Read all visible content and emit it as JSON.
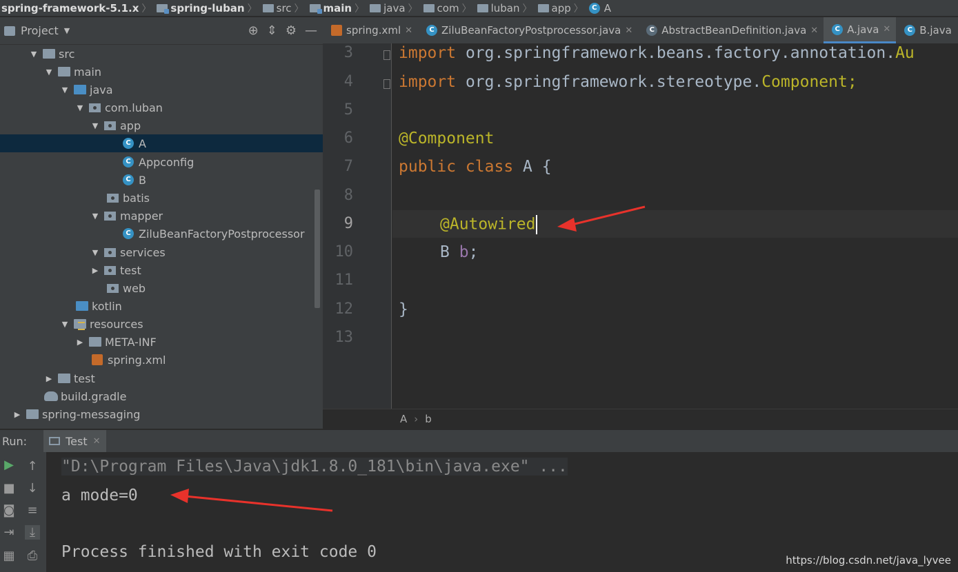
{
  "breadcrumb": [
    {
      "label": "spring-framework-5.1.x",
      "icon": "none",
      "bold": true
    },
    {
      "label": "spring-luban",
      "icon": "module-folder-icon",
      "bold": true
    },
    {
      "label": "src",
      "icon": "folder-icon",
      "bold": false
    },
    {
      "label": "main",
      "icon": "module-folder-icon",
      "bold": true
    },
    {
      "label": "java",
      "icon": "folder-icon",
      "bold": false
    },
    {
      "label": "com",
      "icon": "folder-icon",
      "bold": false
    },
    {
      "label": "luban",
      "icon": "folder-icon",
      "bold": false
    },
    {
      "label": "app",
      "icon": "folder-icon",
      "bold": false
    },
    {
      "label": "A",
      "icon": "class-icon",
      "bold": false
    }
  ],
  "project": {
    "title": "Project",
    "tree": [
      {
        "label": "src",
        "arrow": "▼",
        "icon": "folder",
        "selected": false
      },
      {
        "label": "main",
        "arrow": "▼",
        "icon": "folder",
        "selected": false
      },
      {
        "label": "java",
        "arrow": "▼",
        "icon": "source-folder",
        "selected": false
      },
      {
        "label": "com.luban",
        "arrow": "▼",
        "icon": "package",
        "selected": false
      },
      {
        "label": "app",
        "arrow": "▼",
        "icon": "package",
        "selected": false
      },
      {
        "label": "A",
        "arrow": "",
        "icon": "class",
        "selected": true
      },
      {
        "label": "Appconfig",
        "arrow": "",
        "icon": "class",
        "selected": false
      },
      {
        "label": "B",
        "arrow": "",
        "icon": "class",
        "selected": false
      },
      {
        "label": "batis",
        "arrow": "",
        "icon": "package",
        "selected": false
      },
      {
        "label": "mapper",
        "arrow": "▼",
        "icon": "package",
        "selected": false
      },
      {
        "label": "ZiluBeanFactoryPostprocessor",
        "arrow": "",
        "icon": "class",
        "selected": false
      },
      {
        "label": "services",
        "arrow": "▼",
        "icon": "package",
        "selected": false
      },
      {
        "label": "test",
        "arrow": "▶",
        "icon": "package",
        "selected": false
      },
      {
        "label": "web",
        "arrow": "",
        "icon": "package",
        "selected": false
      },
      {
        "label": "kotlin",
        "arrow": "",
        "icon": "source-folder",
        "selected": false
      },
      {
        "label": "resources",
        "arrow": "▼",
        "icon": "resources-folder",
        "selected": false
      },
      {
        "label": "META-INF",
        "arrow": "▶",
        "icon": "folder",
        "selected": false
      },
      {
        "label": "spring.xml",
        "arrow": "",
        "icon": "xml",
        "selected": false
      },
      {
        "label": "test",
        "arrow": "▶",
        "icon": "folder",
        "selected": false
      },
      {
        "label": "build.gradle",
        "arrow": "",
        "icon": "gradle",
        "selected": false
      },
      {
        "label": "spring-messaging",
        "arrow": "▶",
        "icon": "folder",
        "selected": false
      }
    ]
  },
  "tabs": [
    {
      "label": "spring.xml",
      "icon": "xml",
      "active": false
    },
    {
      "label": "ZiluBeanFactoryPostprocessor.java",
      "icon": "class",
      "active": false
    },
    {
      "label": "AbstractBeanDefinition.java",
      "icon": "abstract-class",
      "active": false
    },
    {
      "label": "A.java",
      "icon": "class",
      "active": true
    },
    {
      "label": "B.java",
      "icon": "class",
      "active": false
    }
  ],
  "editor": {
    "line_numbers": [
      "3",
      "4",
      "5",
      "6",
      "7",
      "8",
      "9",
      "10",
      "11",
      "12",
      "13"
    ],
    "code": {
      "l3_kw": "import",
      "l3_rest": " org.springframework.beans.factory.annotation.",
      "l3_tail": "Au",
      "l4_kw": "import",
      "l4_rest": " org.springframework.stereotype.",
      "l4_tail": "Component;",
      "l6": "@Component",
      "l7_kw": "public class",
      "l7_rest": " A {",
      "l9": "@Autowired",
      "l10_type": "B ",
      "l10_field": "b",
      "l10_end": ";",
      "l12": "}"
    },
    "breadcrumb": [
      "A",
      "b"
    ]
  },
  "run": {
    "label": "Run:",
    "tab": "Test",
    "console": [
      "\"D:\\Program Files\\Java\\jdk1.8.0_181\\bin\\java.exe\" ...",
      "a mode=0",
      "Process finished with exit code 0"
    ]
  },
  "watermark": "https://blog.csdn.net/java_lyvee",
  "colors": {
    "accent": "#4a88c7",
    "arrow": "#e8322b",
    "keyword": "#cc7832",
    "annotation": "#bbb529"
  }
}
